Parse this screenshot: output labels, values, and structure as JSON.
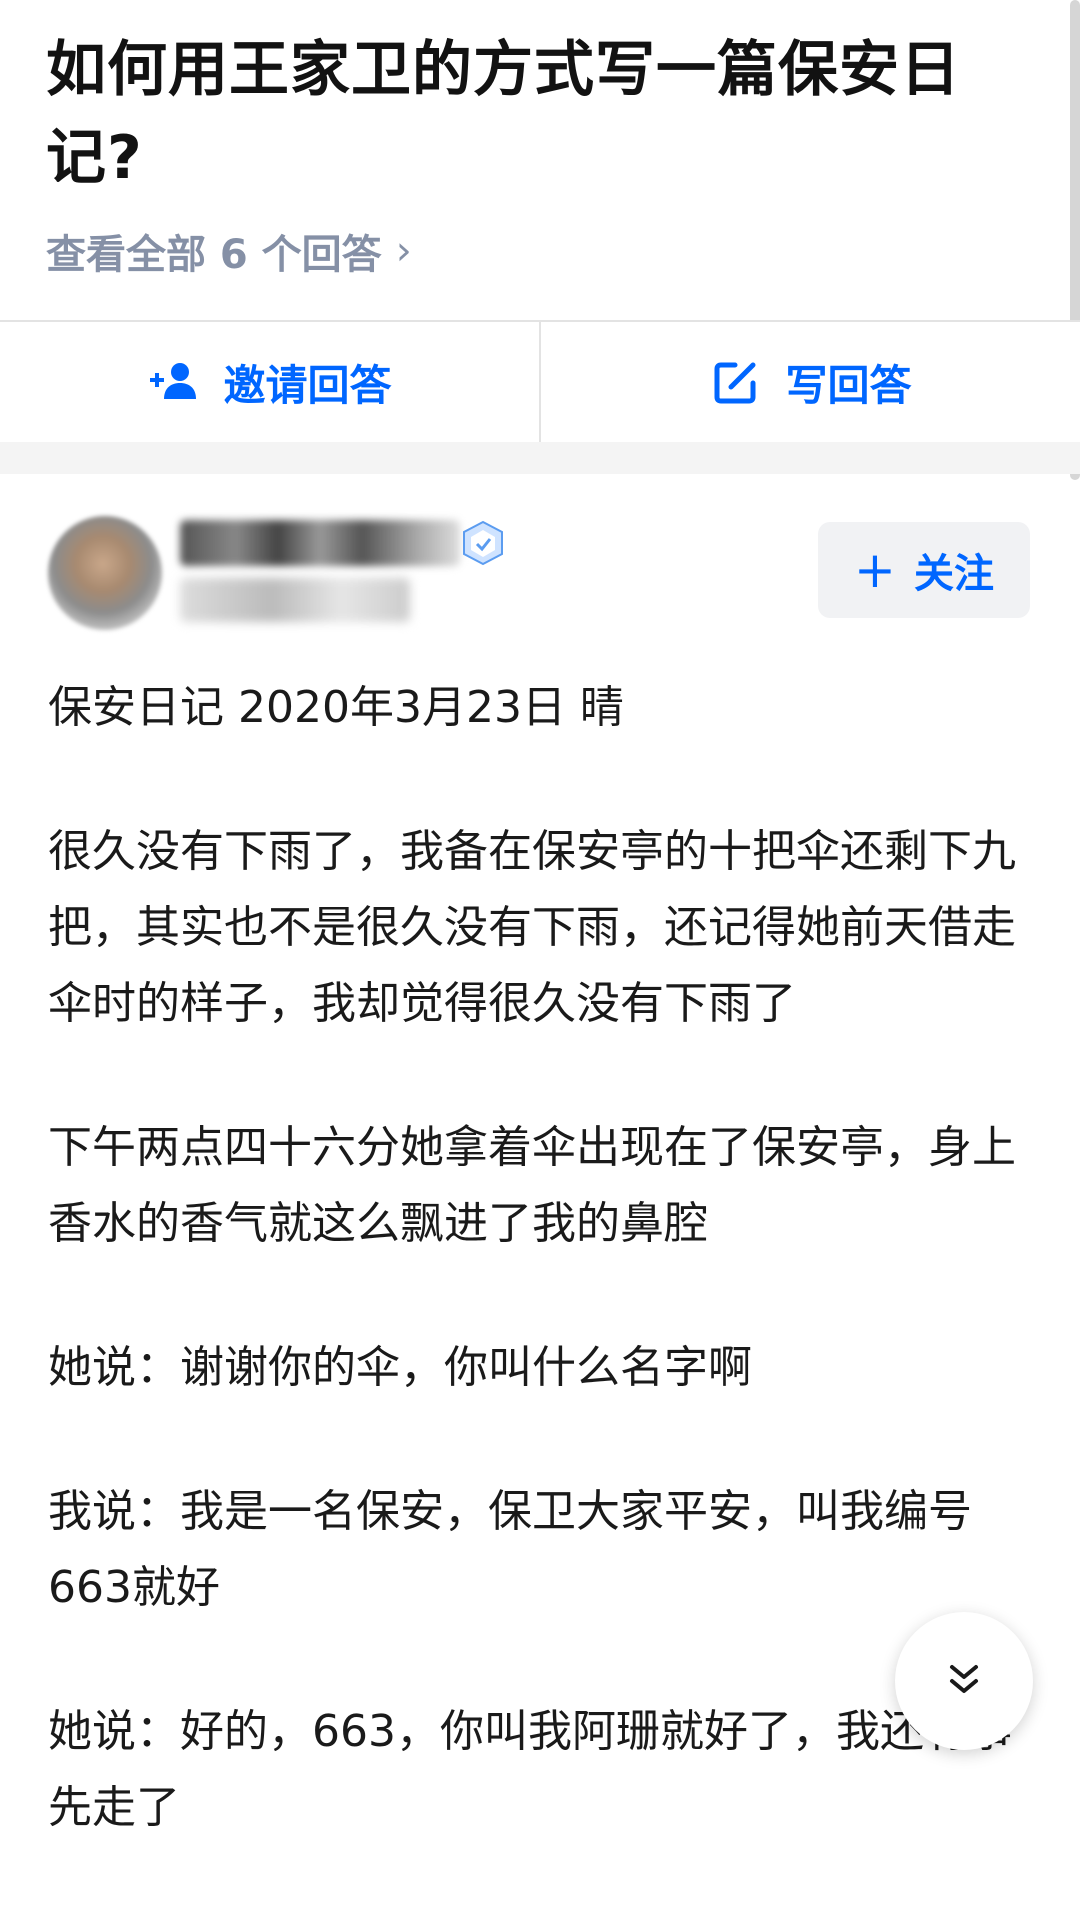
{
  "question": {
    "title": "如何用王家卫的方式写一篇保安日记?",
    "view_all": "查看全部 6 个回答",
    "chevron": "›"
  },
  "actions": {
    "invite_label": "邀请回答",
    "write_label": "写回答",
    "invite_icon": "add-person-icon",
    "write_icon": "edit-icon"
  },
  "author": {
    "follow_label": "关注",
    "follow_plus": "+"
  },
  "answer": {
    "paragraphs": [
      "保安日记 2020年3月23日 晴",
      "很久没有下雨了，我备在保安亭的十把伞还剩下九把，其实也不是很久没有下雨，还记得她前天借走伞时的样子，我却觉得很久没有下雨了",
      "下午两点四十六分她拿着伞出现在了保安亭，身上香水的香气就这么飘进了我的鼻腔",
      "她说：谢谢你的伞，你叫什么名字啊",
      "我说：我是一名保安，保卫大家平安，叫我编号663就好",
      "她说：好的，663，你叫我阿珊就好了，我还有事先走了"
    ]
  },
  "colors": {
    "accent": "#0066ff",
    "muted": "#8590a6",
    "text": "#1a1a1a"
  }
}
